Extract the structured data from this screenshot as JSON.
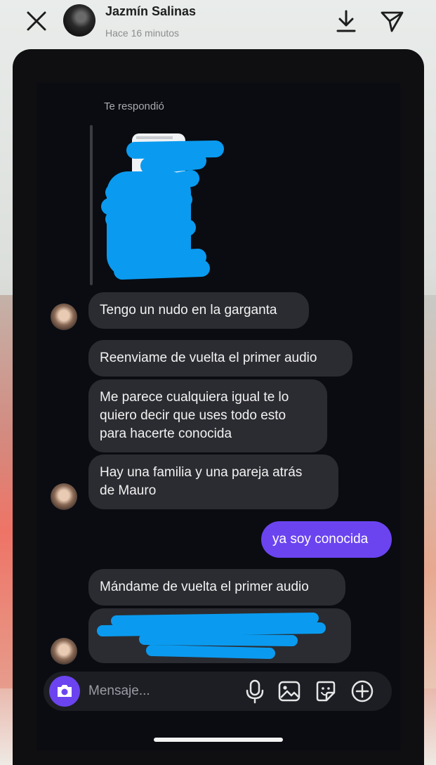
{
  "header": {
    "name": "Jazmín Salinas",
    "time": "Hace 16 minutos"
  },
  "reply": {
    "label": "Te respondió"
  },
  "messages": [
    {
      "text": "Tengo un nudo en la garganta"
    },
    {
      "text": "Reenviame de vuelta el primer audio"
    },
    {
      "text": "Me parece cualquiera igual te lo\nquiero decir que uses todo esto\npara hacerte conocida"
    },
    {
      "text": "Hay una familia y una pareja atrás\nde Mauro"
    },
    {
      "text": "ya soy conocida"
    },
    {
      "text": "Mándame de vuelta el primer audio"
    }
  ],
  "composer": {
    "placeholder": "Mensaje..."
  },
  "colors": {
    "accent": "#6b44f0",
    "redaction": "#0a9bf0",
    "bubble": "#2b2c31",
    "screen_bg": "#0a0c12"
  }
}
